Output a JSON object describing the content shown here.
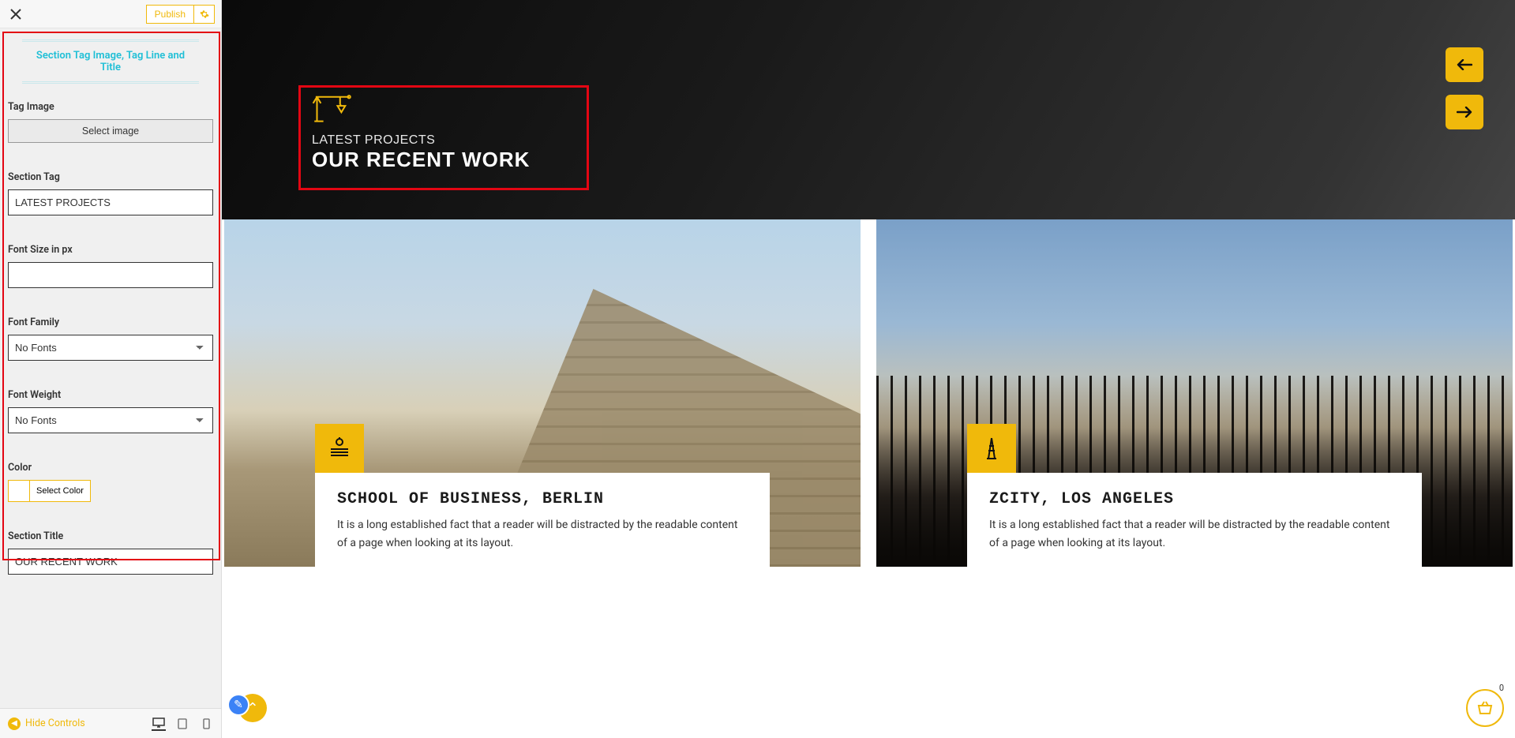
{
  "topbar": {
    "publish_label": "Publish"
  },
  "panel": {
    "header": "Section Tag Image, Tag Line and Title",
    "tag_image_label": "Tag Image",
    "select_image_btn": "Select image",
    "section_tag_label": "Section Tag",
    "section_tag_value": "LATEST PROJECTS",
    "font_size_label": "Font Size in px",
    "font_size_value": "",
    "font_family_label": "Font Family",
    "font_family_value": "No Fonts",
    "font_weight_label": "Font Weight",
    "font_weight_value": "No Fonts",
    "color_label": "Color",
    "select_color_btn": "Select Color",
    "section_title_label": "Section Title",
    "section_title_value": "OUR RECENT WORK"
  },
  "bottombar": {
    "hide_controls": "Hide Controls"
  },
  "preview": {
    "section_tag": "LATEST PROJECTS",
    "section_title": "OUR RECENT WORK",
    "projects": [
      {
        "title": "SCHOOL OF BUSINESS, BERLIN",
        "desc": "It is a long established fact that a reader will be distracted by the readable content of a page when looking at its layout."
      },
      {
        "title": "ZCITY, LOS ANGELES",
        "desc": "It is a long established fact that a reader will be distracted by the readable content of a page when looking at its layout."
      }
    ]
  },
  "cart": {
    "count": "0"
  }
}
